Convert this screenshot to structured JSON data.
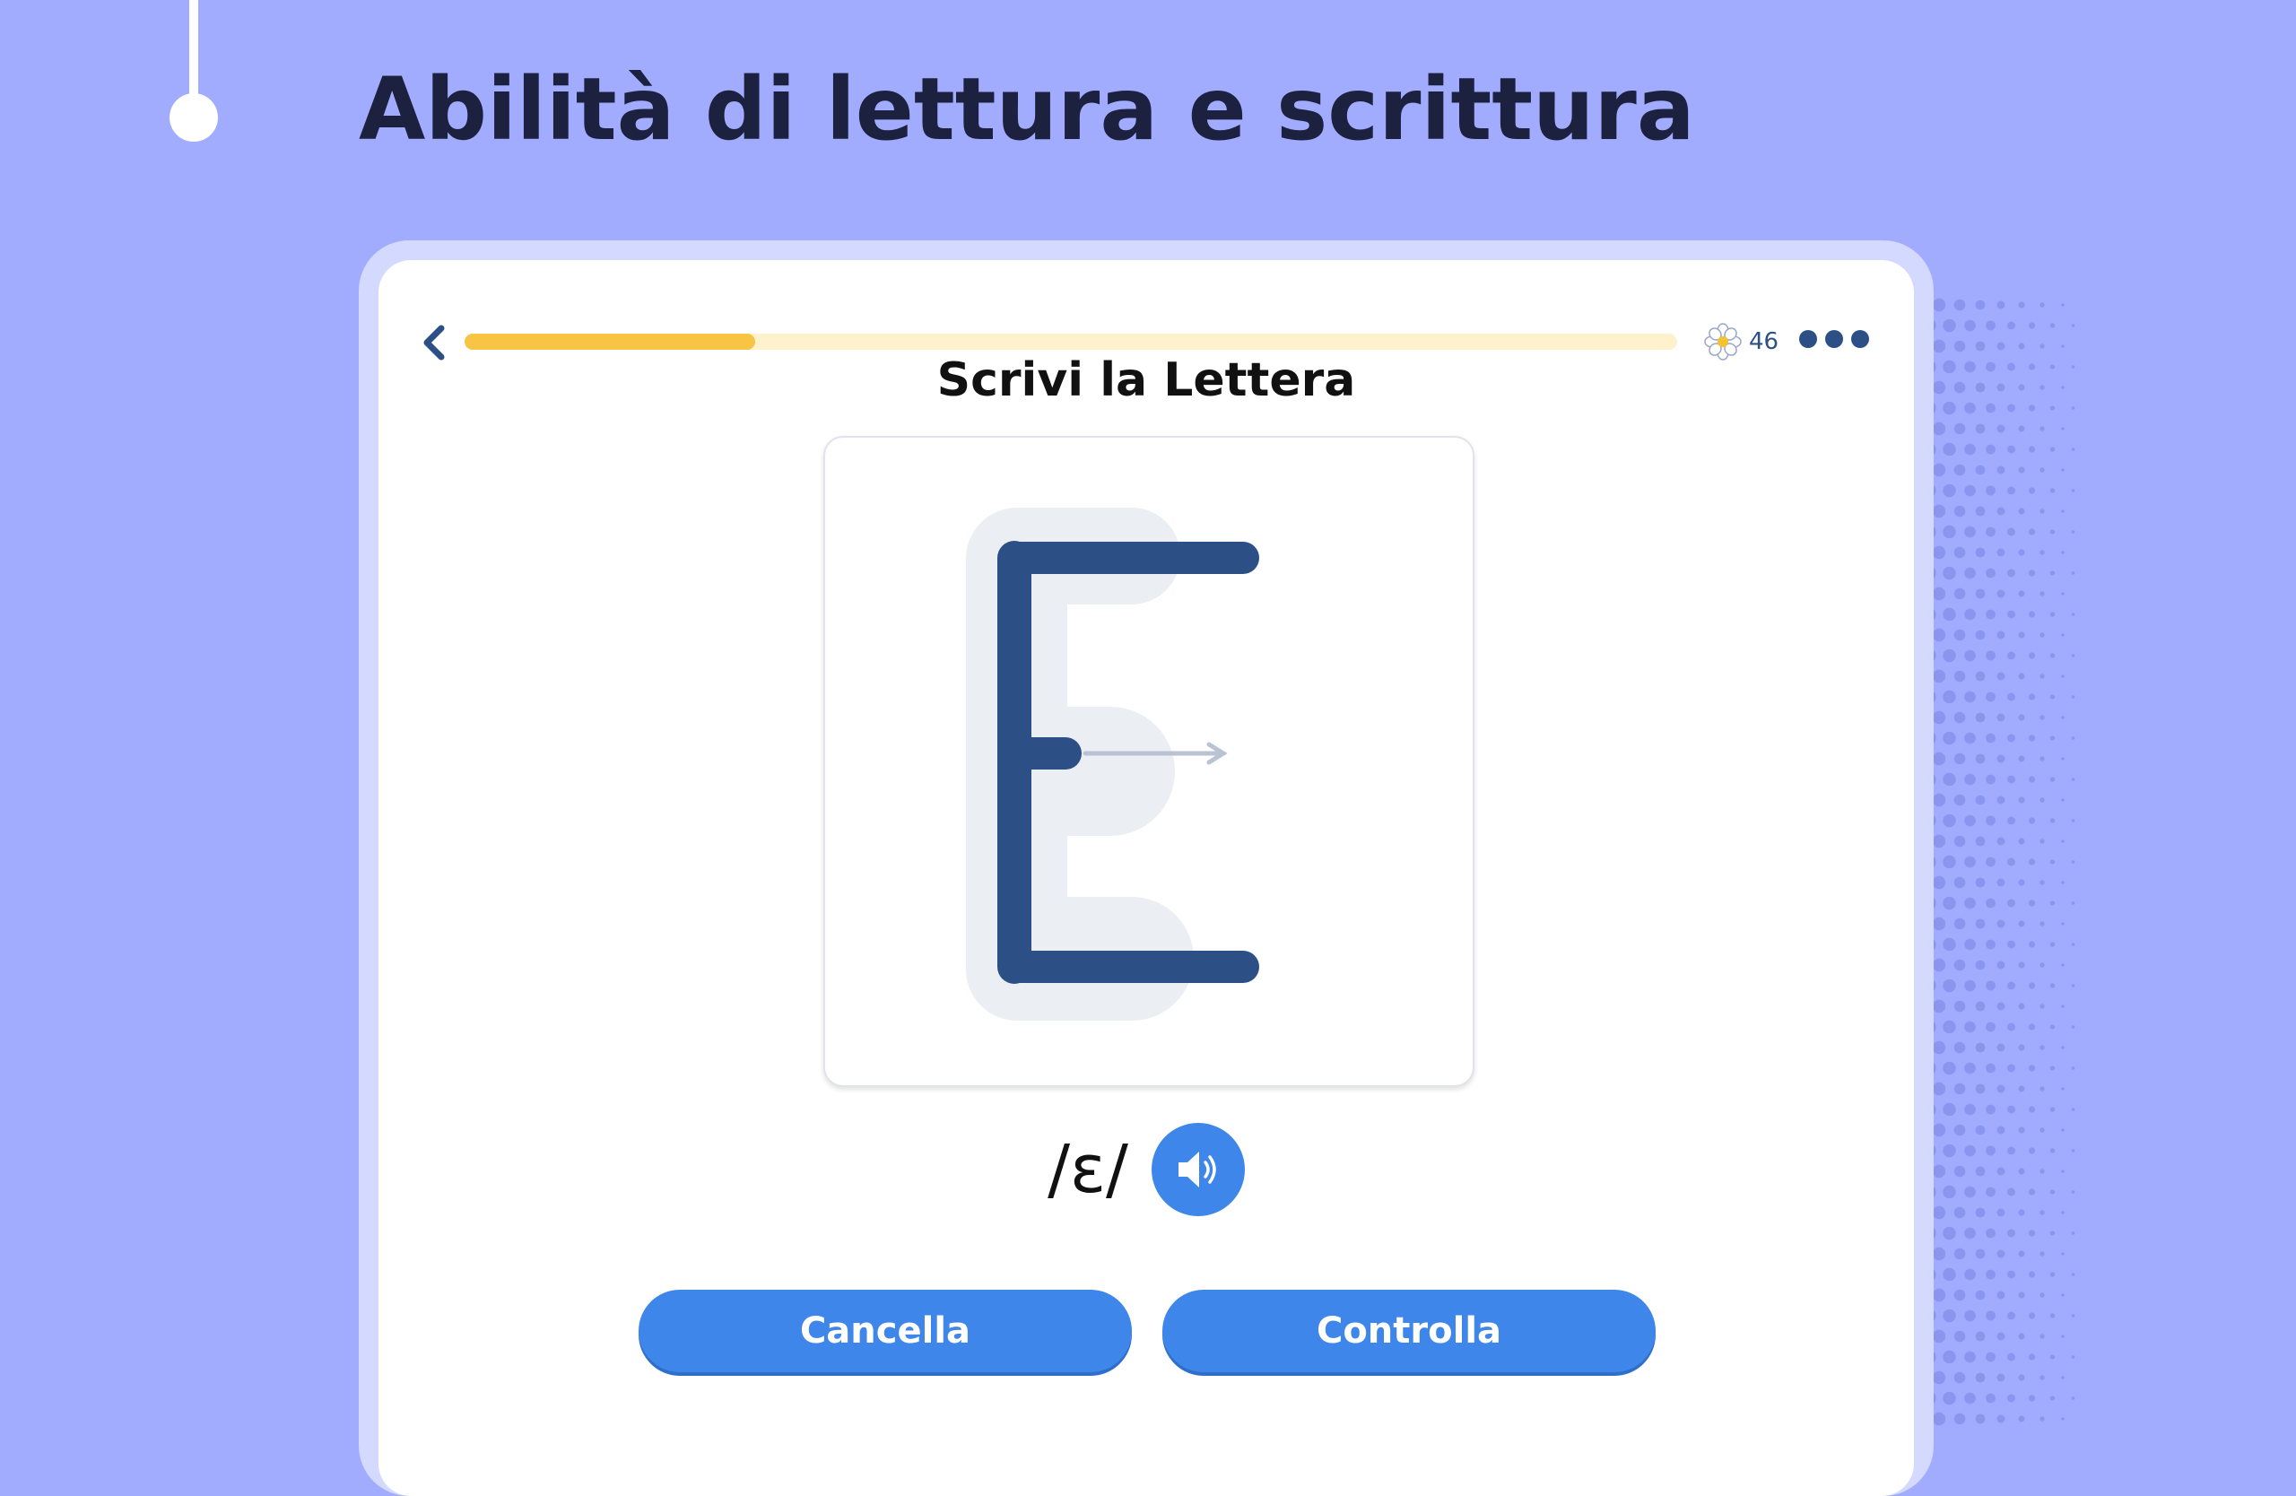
{
  "page_title": "Abilità di lettura e scrittura",
  "lesson": {
    "progress_fraction": 0.24,
    "points": "46",
    "points_icon": "flower-icon",
    "task_title": "Scrivi la Lettera",
    "target_letter": "E",
    "phonetic": "/ɛ/",
    "audio_icon": "speaker-icon"
  },
  "buttons": {
    "clear_label": "Cancella",
    "check_label": "Controlla"
  },
  "colors": {
    "background": "#a2acfe",
    "accent_blue": "#3e86ea",
    "letter_stroke": "#2c4f85",
    "progress_fill": "#f7c543",
    "progress_track": "#fdf2cc"
  }
}
